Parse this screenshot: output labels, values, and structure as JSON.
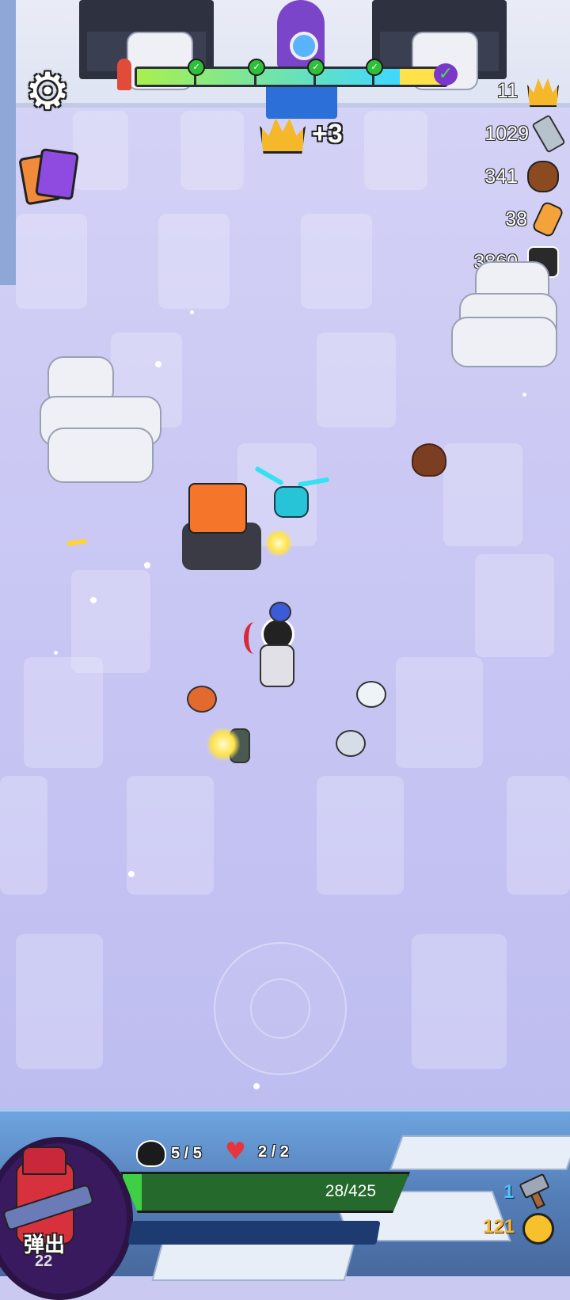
{
  "hud": {
    "reward_label": "+3",
    "resources": [
      {
        "value": "11",
        "icon": "crown-icon"
      },
      {
        "value": "1029",
        "icon": "bolt-icon"
      },
      {
        "value": "341",
        "icon": "barrel-icon"
      },
      {
        "value": "38",
        "icon": "vial-icon"
      },
      {
        "value": "3860",
        "icon": "skull-icon"
      }
    ],
    "level_progress": 0.85,
    "checkpoints": 5
  },
  "bottom": {
    "hero_action_label": "弹出",
    "hero_action_count": "22",
    "enemies_stat": "5 / 5",
    "lives_stat": "2 / 2",
    "hp_text": "28/425",
    "hp_fraction": 0.066,
    "hammer_count": "1",
    "coin_count": "121"
  },
  "colors": {
    "hp_green": "#3fcf44",
    "coin_gold": "#f6c12a",
    "arena_floor": "#c8c6f3"
  }
}
